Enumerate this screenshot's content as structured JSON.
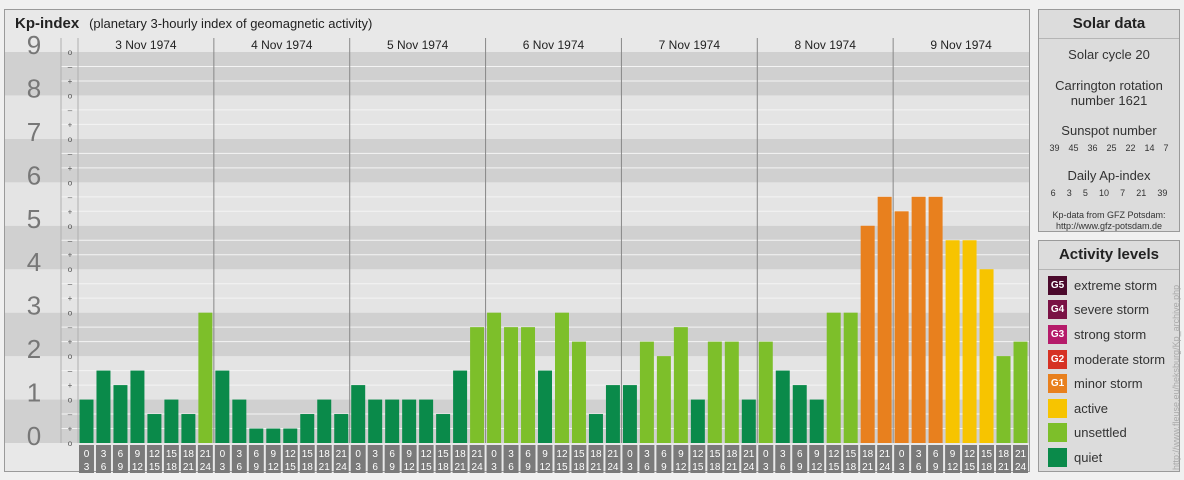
{
  "header": {
    "title": "Kp-index",
    "subtitle": "(planetary 3-hourly index of geomagnetic activity)"
  },
  "chart_data": {
    "type": "bar",
    "title": "Kp-index",
    "subtitle": "(planetary 3-hourly index of geomagnetic activity)",
    "ylim": [
      0,
      9
    ],
    "y_ticks": [
      "0",
      "1",
      "2",
      "3",
      "4",
      "5",
      "6",
      "7",
      "8",
      "9"
    ],
    "y_minor_ticks": [
      "o",
      "+",
      "–"
    ],
    "days": [
      "3 Nov 1974",
      "4 Nov 1974",
      "5 Nov 1974",
      "6 Nov 1974",
      "7 Nov 1974",
      "8 Nov 1974",
      "9 Nov 1974"
    ],
    "interval_labels": [
      [
        "0",
        "3"
      ],
      [
        "3",
        "6"
      ],
      [
        "6",
        "9"
      ],
      [
        "9",
        "12"
      ],
      [
        "12",
        "15"
      ],
      [
        "15",
        "18"
      ],
      [
        "18",
        "21"
      ],
      [
        "21",
        "24"
      ]
    ],
    "values": [
      1.0,
      1.667,
      1.333,
      1.667,
      0.667,
      1.0,
      0.667,
      3.0,
      1.667,
      1.0,
      0.333,
      0.333,
      0.333,
      0.667,
      1.0,
      0.667,
      1.333,
      1.0,
      1.0,
      1.0,
      1.0,
      0.667,
      1.667,
      2.667,
      3.0,
      2.667,
      2.667,
      1.667,
      3.0,
      2.333,
      0.667,
      1.333,
      1.333,
      2.333,
      2.0,
      2.667,
      1.0,
      2.333,
      2.333,
      1.0,
      2.333,
      1.667,
      1.333,
      1.0,
      3.0,
      3.0,
      5.0,
      5.667,
      5.333,
      5.667,
      5.667,
      4.667,
      4.667,
      4.0,
      2.0,
      2.333
    ],
    "grid": true,
    "legend": "right"
  },
  "activity_levels": {
    "title": "Activity levels",
    "items": [
      {
        "badge": "G5",
        "label": "extreme storm",
        "color": "#4b0a2c"
      },
      {
        "badge": "G4",
        "label": "severe storm",
        "color": "#7a1245"
      },
      {
        "badge": "G3",
        "label": "strong storm",
        "color": "#b51b6a"
      },
      {
        "badge": "G2",
        "label": "moderate storm",
        "color": "#d63224"
      },
      {
        "badge": "G1",
        "label": "minor storm",
        "color": "#e8801e"
      },
      {
        "badge": "",
        "label": "active",
        "color": "#f7c400"
      },
      {
        "badge": "",
        "label": "unsettled",
        "color": "#7dbf2a"
      },
      {
        "badge": "",
        "label": "quiet",
        "color": "#0a8a4a"
      }
    ]
  },
  "solar_data": {
    "title": "Solar data",
    "solar_cycle": "Solar cycle 20",
    "carrington_line1": "Carrington rotation",
    "carrington_line2": "number 1621",
    "sunspot_title": "Sunspot number",
    "sunspot_numbers": [
      "39",
      "45",
      "36",
      "25",
      "22",
      "14",
      "7"
    ],
    "ap_title": "Daily Ap-index",
    "ap_values": [
      "6",
      "3",
      "5",
      "10",
      "7",
      "21",
      "39"
    ],
    "credit_line1": "Kp-data from GFZ Potsdam:",
    "credit_line2": "http://www.gfz-potsdam.de"
  },
  "side_credit": "http://www.fleuse.eu/heksburg/Kp_archive.php"
}
